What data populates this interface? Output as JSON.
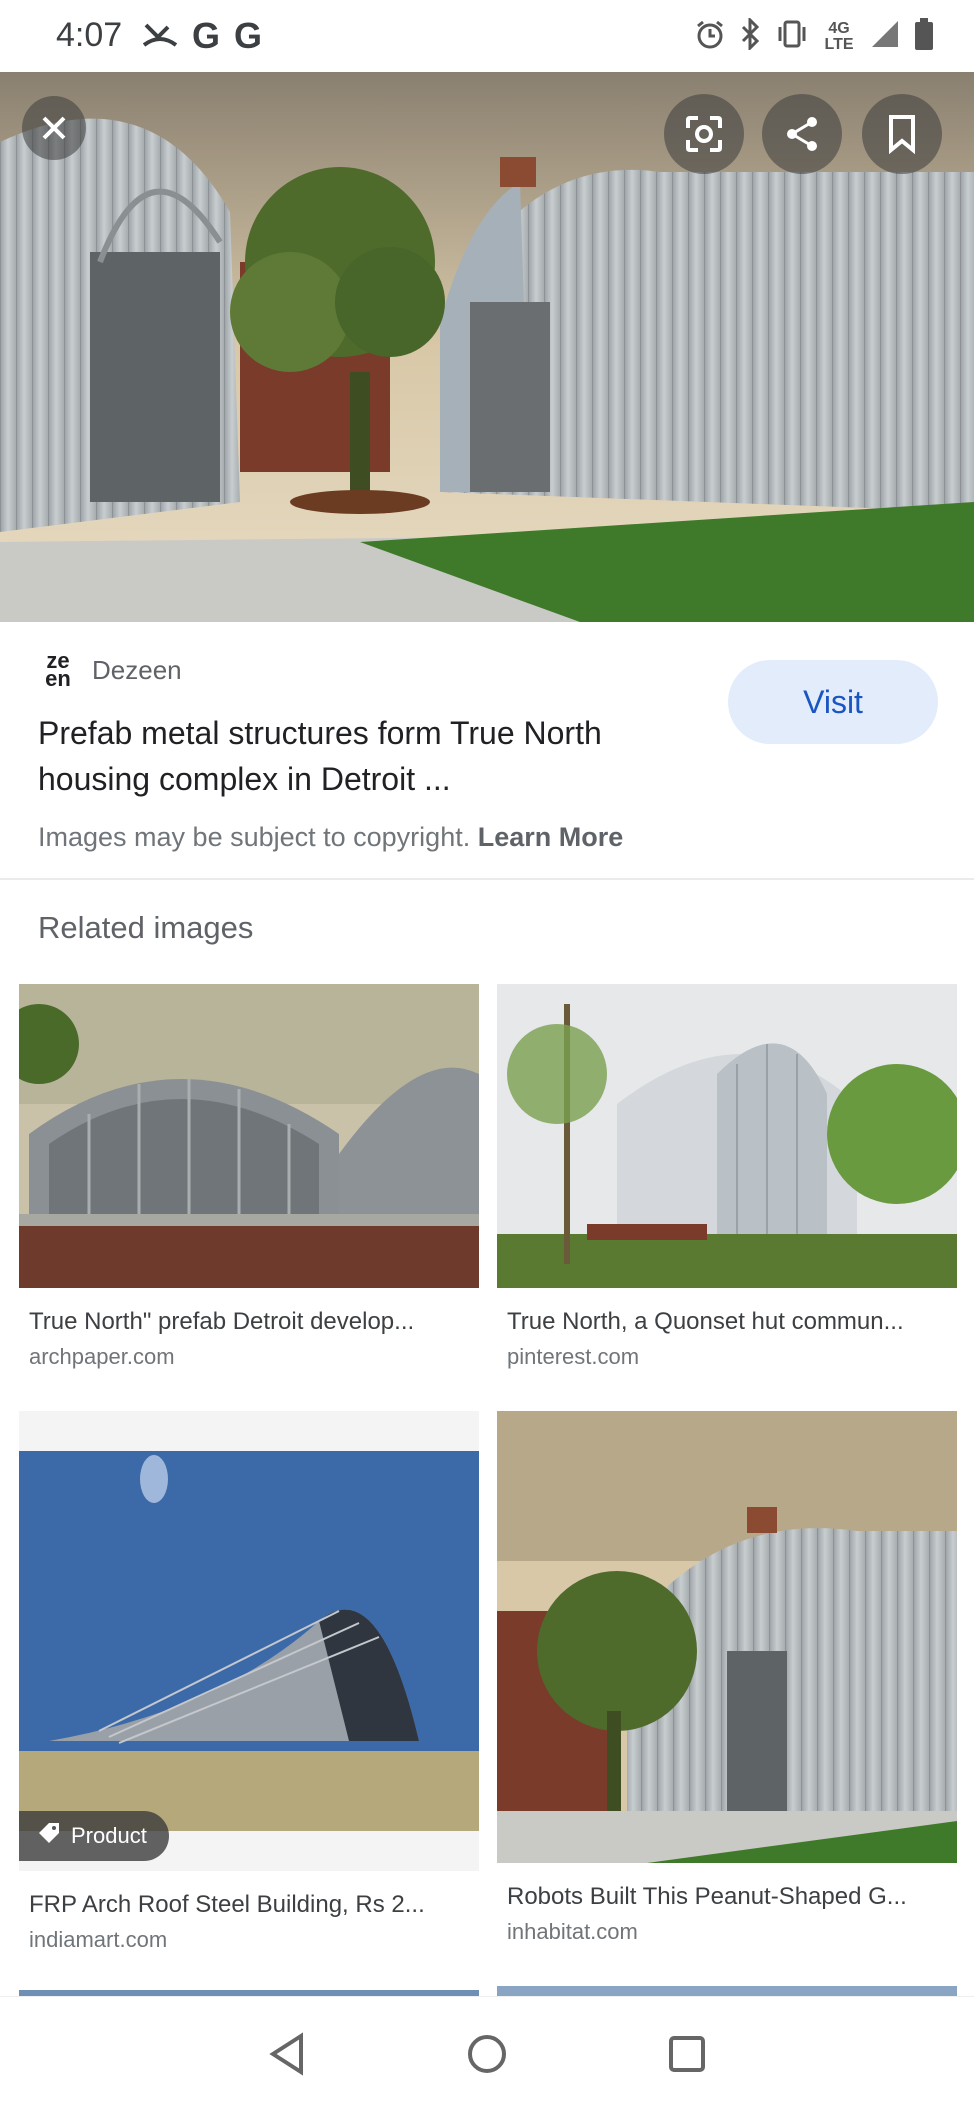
{
  "status_bar": {
    "time": "4:07",
    "g_icon_label": "G",
    "network_label": "4G LTE"
  },
  "hero": {
    "icons": [
      "close-icon",
      "lens-icon",
      "share-icon",
      "bookmark-icon"
    ]
  },
  "source": {
    "logo_text_top": "ze",
    "logo_text_bottom": "en",
    "name": "Dezeen",
    "title": "Prefab metal structures form True North housing complex in Detroit ...",
    "visit_label": "Visit",
    "copyright_text": "Images may be subject to copyright.",
    "learn_more": "Learn More"
  },
  "related": {
    "heading": "Related images",
    "items": [
      {
        "title": "True North\" prefab Detroit develop...",
        "site": "archpaper.com"
      },
      {
        "title": "True North, a Quonset hut commun...",
        "site": "pinterest.com"
      },
      {
        "title": "FRP Arch Roof Steel Building, Rs 2...",
        "site": "indiamart.com",
        "badge": "Product"
      },
      {
        "title": "Robots Built This Peanut-Shaped G...",
        "site": "inhabitat.com"
      }
    ]
  },
  "nav": {
    "icons": [
      "back-icon",
      "home-icon",
      "recents-icon"
    ]
  }
}
